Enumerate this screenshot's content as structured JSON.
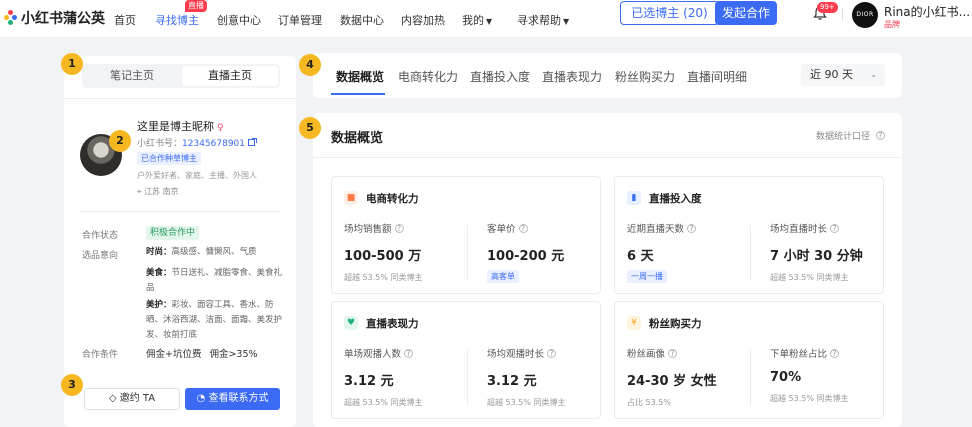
{
  "app": {
    "logo_text": "小红书蒲公英",
    "brand_colors": {
      "accent": "#3b6bf5",
      "red": "#ff3b4e",
      "step": "#f5b821",
      "green": "#2a9d5c"
    }
  },
  "nav": {
    "items": [
      {
        "label": "首页"
      },
      {
        "label": "寻找博主",
        "active": true,
        "tag": "直播"
      },
      {
        "label": "创意中心"
      },
      {
        "label": "订单管理"
      },
      {
        "label": "数据中心"
      },
      {
        "label": "内容加热"
      },
      {
        "label": "我的",
        "dropdown": true
      },
      {
        "label": "寻求帮助",
        "dropdown": true
      }
    ],
    "selected_button": "已选博主 (20)",
    "launch_button": "发起合作",
    "notification_badge": "99+",
    "user_avatar_text": "DIOR",
    "user_name": "Rina的小红书...",
    "user_tag": "品牌"
  },
  "steps": [
    "1",
    "2",
    "3",
    "4",
    "5"
  ],
  "profile": {
    "segment": [
      "笔记主页",
      "直播主页"
    ],
    "name": "这里是博主昵称",
    "gender_icon": "♀",
    "id_label": "小红书号：",
    "id_value": "12345678901",
    "coop_tag": "已合作种草博主",
    "tags": "户外爱好者、家庭、主播、外国人",
    "location": "江苏 南京",
    "status_label": "合作状态",
    "status_value": "积极合作中",
    "pref_label": "选品意向",
    "prefs": [
      {
        "cat": "时尚：",
        "items": "高级感、慵懒风、气质"
      },
      {
        "cat": "美食：",
        "items": "节日送礼、减脂零食、美食礼品"
      },
      {
        "cat": "美护：",
        "items": "彩妆、面容工具、香水、防晒、沐浴西湖、洁面、面霜、美发护发、妆前打底"
      }
    ],
    "terms_label": "合作条件",
    "terms": [
      "佣金+坑位费",
      "佣金>35%"
    ],
    "invite_button": "邀约 TA",
    "contact_button": "查看联系方式"
  },
  "tabs": {
    "items": [
      "数据概览",
      "电商转化力",
      "直播投入度",
      "直播表现力",
      "粉丝购买力",
      "直播间明细"
    ],
    "range": "近 90 天"
  },
  "overview": {
    "title": "数据概览",
    "link": "数据统计口径",
    "cards": [
      {
        "title": "电商转化力",
        "icon": "bag-icon",
        "icon_color": "#ff7a45",
        "metrics": [
          {
            "label": "场均销售额",
            "value": "100-500 万",
            "sub": "超越 53.5% 同类博主"
          },
          {
            "label": "客单价",
            "value": "100-200 元",
            "tag": "高客单"
          }
        ]
      },
      {
        "title": "直播投入度",
        "icon": "bar-chart-icon",
        "icon_color": "#3b6bf5",
        "metrics": [
          {
            "label": "近期直播天数",
            "value": "6 天",
            "tag": "一周一播"
          },
          {
            "label": "场均直播时长",
            "value": "7 小时 30 分钟",
            "sub": "超越 53.5% 同类博主"
          }
        ]
      },
      {
        "title": "直播表现力",
        "icon": "heart-icon",
        "icon_color": "#20b27a",
        "metrics": [
          {
            "label": "单场观播人数",
            "value": "3.12 元",
            "sub": "超越 53.5% 同类博主"
          },
          {
            "label": "场均观播时长",
            "value": "3.12 元",
            "sub": "超越 53.5% 同类博主"
          }
        ]
      },
      {
        "title": "粉丝购买力",
        "icon": "yen-icon",
        "icon_color": "#f5a623",
        "metrics": [
          {
            "label": "粉丝画像",
            "value": "24-30 岁  女性",
            "sub": "占比 53.5%"
          },
          {
            "label": "下单粉丝占比",
            "value": "70%",
            "sub": "超越 53.5% 同类博主"
          }
        ]
      }
    ]
  }
}
